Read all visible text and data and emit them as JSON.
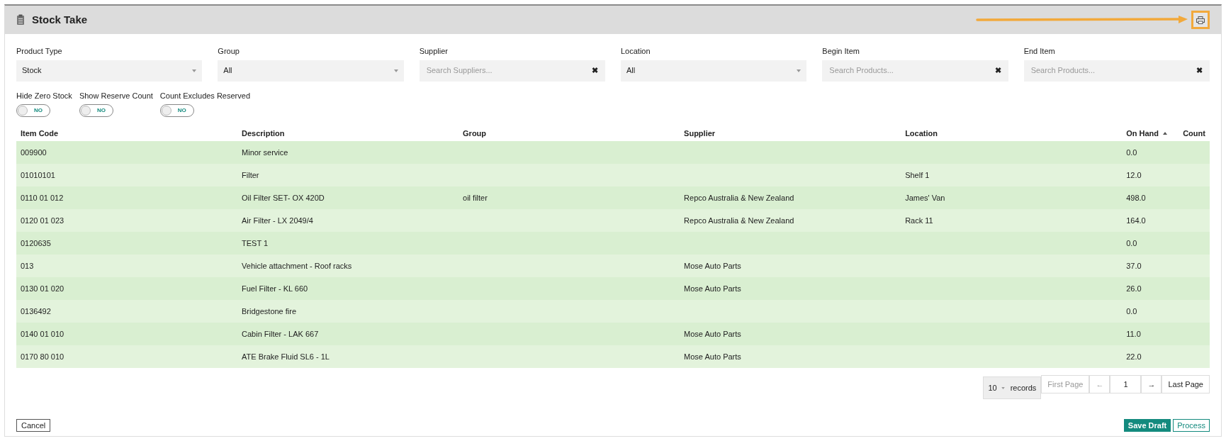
{
  "header": {
    "title": "Stock Take"
  },
  "filters": [
    {
      "kind": "select",
      "label": "Product Type",
      "value": "Stock"
    },
    {
      "kind": "select",
      "label": "Group",
      "value": "All"
    },
    {
      "kind": "search",
      "label": "Supplier",
      "placeholder": "Search Suppliers...",
      "clear": "✖"
    },
    {
      "kind": "select",
      "label": "Location",
      "value": "All"
    },
    {
      "kind": "search",
      "label": "Begin Item",
      "placeholder": "Search Products...",
      "clear": "✖"
    },
    {
      "kind": "search",
      "label": "End Item",
      "placeholder": "Search Products...",
      "clear": "✖"
    }
  ],
  "toggles": [
    {
      "label": "Hide Zero Stock",
      "on": false,
      "state": "NO"
    },
    {
      "label": "Show Reserve Count",
      "on": false,
      "state": "NO"
    },
    {
      "label": "Count Excludes Reserved",
      "on": false,
      "state": "NO"
    }
  ],
  "table": {
    "columns": [
      {
        "label": "Item Code"
      },
      {
        "label": "Description"
      },
      {
        "label": "Group"
      },
      {
        "label": "Supplier"
      },
      {
        "label": "Location"
      },
      {
        "label": "On Hand",
        "sorted": true
      },
      {
        "label": "Count"
      }
    ],
    "rows": [
      [
        "009900",
        "Minor service",
        "",
        "",
        "",
        "0.0",
        ""
      ],
      [
        "01010101",
        "Filter",
        "",
        "",
        "Shelf 1",
        "12.0",
        ""
      ],
      [
        "0110 01 012",
        "Oil Filter SET- OX 420D",
        "oil filter",
        "Repco Australia & New Zealand",
        "James' Van",
        "498.0",
        ""
      ],
      [
        "0120 01 023",
        "Air Filter - LX 2049/4",
        "",
        "Repco Australia & New Zealand",
        "Rack 11",
        "164.0",
        ""
      ],
      [
        "0120635",
        "TEST 1",
        "",
        "",
        "",
        "0.0",
        ""
      ],
      [
        "013",
        "Vehicle attachment - Roof racks",
        "",
        "Mose Auto Parts",
        "",
        "37.0",
        ""
      ],
      [
        "0130 01 020",
        "Fuel Filter - KL 660",
        "",
        "Mose Auto Parts",
        "",
        "26.0",
        ""
      ],
      [
        "0136492",
        "Bridgestone fire",
        "",
        "",
        "",
        "0.0",
        ""
      ],
      [
        "0140 01 010",
        "Cabin Filter - LAK 667",
        "",
        "Mose Auto Parts",
        "",
        "11.0",
        ""
      ],
      [
        "0170 80 010",
        "ATE Brake Fluid SL6 - 1L",
        "",
        "Mose Auto Parts",
        "",
        "22.0",
        ""
      ]
    ]
  },
  "pagination": {
    "page_size": "10",
    "records_label": "records",
    "first": "First Page",
    "prev": "←",
    "page": "1",
    "next": "→",
    "last": "Last Page"
  },
  "actions": {
    "cancel": "Cancel",
    "save_draft": "Save Draft",
    "process": "Process"
  }
}
